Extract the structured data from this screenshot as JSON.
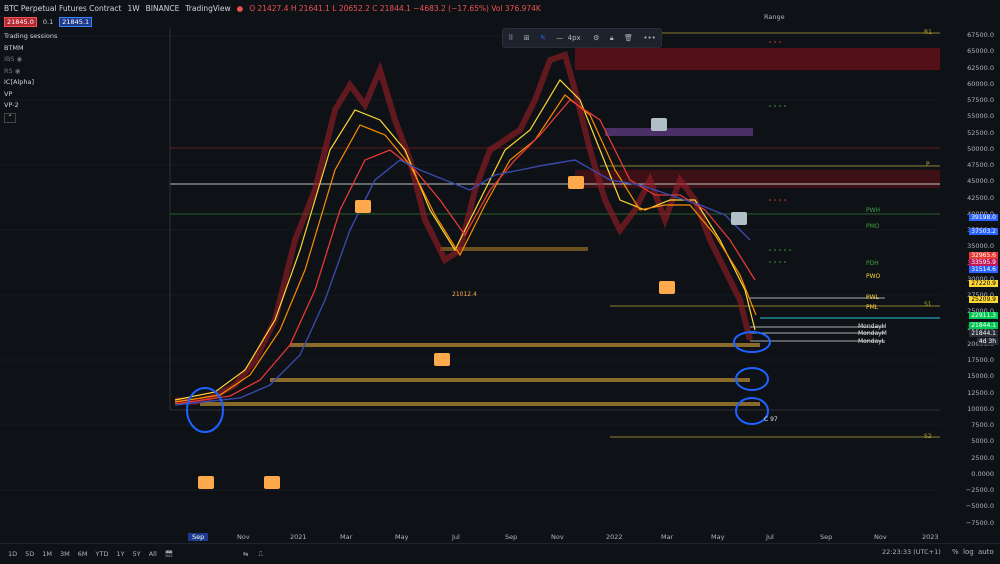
{
  "header": {
    "title": "BTC Perpetual Futures Contract",
    "interval": "1W",
    "exchange": "BINANCE",
    "source": "TradingView",
    "ohlc": "O 21427.4  H 21641.1  L 20652.2  C 21844.1  −4683.2 (−17.65%)  Vol 376.974K"
  },
  "prices": {
    "bid": "21845.0",
    "spread": "0.1",
    "ask": "21845.1"
  },
  "legend": {
    "trading_sessions": "Trading sessions",
    "btmm": "BTMM",
    "ibs": "IBS",
    "rs": "RS",
    "ic": "IC[Alpha]",
    "vp": "VP",
    "vp2": "VP-2"
  },
  "toolbar": {
    "width_label": "4px"
  },
  "range_label": "Range",
  "y_axis": [
    "67500.0",
    "65000.0",
    "62500.0",
    "60000.0",
    "57500.0",
    "55000.0",
    "52500.0",
    "50000.0",
    "47500.0",
    "45000.0",
    "42500.0",
    "40000.0",
    "37500.0",
    "35000.0",
    "32500.0",
    "30000.0",
    "27500.0",
    "25000.0",
    "22500.0",
    "20000.0",
    "17500.0",
    "15000.0",
    "12500.0",
    "10000.0",
    "7500.0",
    "5000.0",
    "2500.0",
    "0.0000",
    "−2500.0",
    "−5000.0",
    "−7500.0"
  ],
  "price_tags": [
    {
      "label": "39198.0",
      "color": "#2962ff"
    },
    {
      "label": "37503.2",
      "color": "#2962ff"
    },
    {
      "label": "32965.6",
      "color": "#e53935"
    },
    {
      "label": "33595.9",
      "color": "#c2185b"
    },
    {
      "label": "31514.6",
      "color": "#2962ff"
    },
    {
      "label": "27220.9",
      "color": "#fdd835"
    },
    {
      "label": "25209.9",
      "color": "#fdd835"
    },
    {
      "label": "22911.3",
      "color": "#00c853"
    },
    {
      "label": "21844.1",
      "color": "#00c853"
    },
    {
      "label": "21844.1",
      "color": "#2a2e39"
    },
    {
      "label": "4d 3h",
      "color": "#2a2e39"
    }
  ],
  "levels": {
    "r1": "R1",
    "p": "P",
    "s1": "S1",
    "s2": "S2",
    "pwh": "PWH",
    "pmo": "PMO",
    "pdh": "PDH",
    "pwo": "PWO",
    "pwl": "PWL",
    "pml": "PML",
    "monday_h": "MondayH",
    "monday_m": "MondayM",
    "monday_l": "MondayL",
    "low_label": "21012.4",
    "c97": "C 97"
  },
  "x_axis": [
    "Sep",
    "Nov",
    "2021",
    "Mar",
    "May",
    "Jul",
    "Sep",
    "Nov",
    "2022",
    "Mar",
    "May",
    "Jul",
    "Sep",
    "Nov",
    "2023"
  ],
  "timeframes": [
    "1D",
    "5D",
    "1M",
    "3M",
    "6M",
    "YTD",
    "1Y",
    "5Y",
    "All"
  ],
  "clock": "22:23:33 (UTC+1)",
  "bottom_right": {
    "percent": "%",
    "log": "log",
    "auto": "auto"
  },
  "colors": {
    "bg": "#0e1116",
    "up": "#26a69a",
    "down": "#ef5350",
    "accent": "#2962ff"
  }
}
